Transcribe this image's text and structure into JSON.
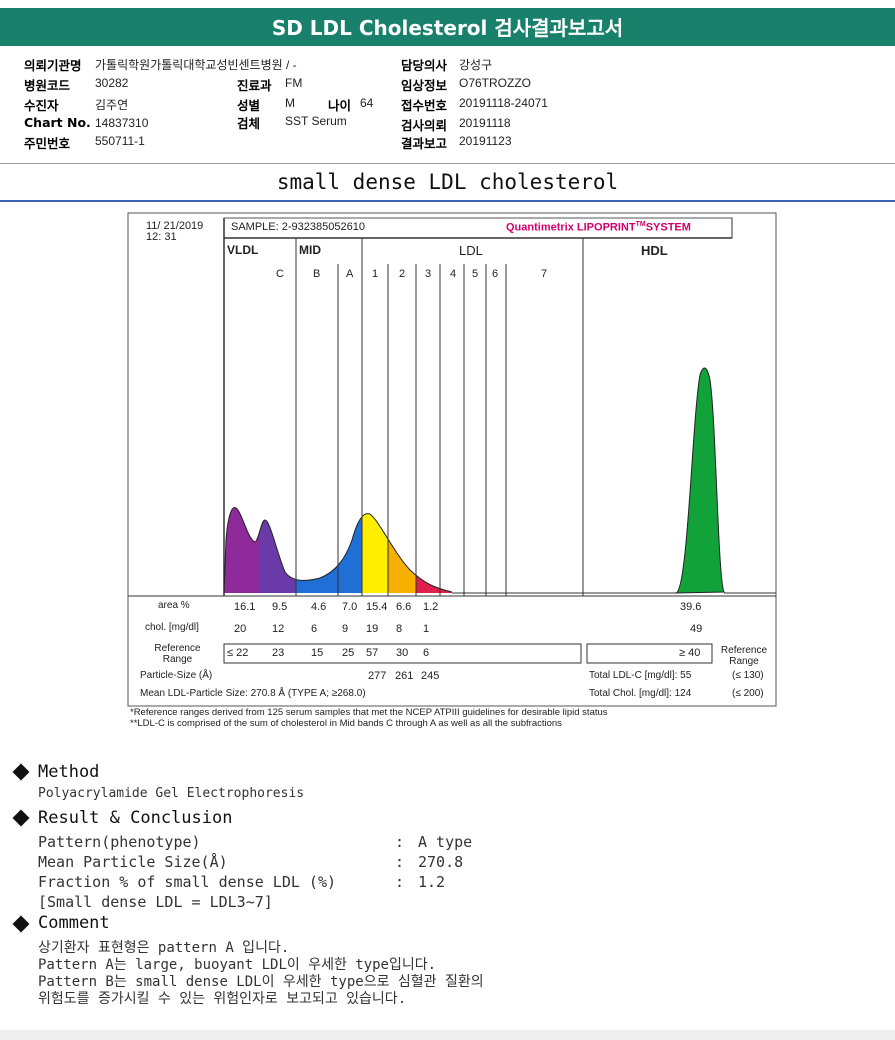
{
  "title": "SD LDL Cholesterol 검사결과보고서",
  "info": {
    "institution_label": "의뢰기관명",
    "institution": "가톨릭학원가톨릭대학교성빈센트병원 / -",
    "hospital_code_label": "병원코드",
    "hospital_code": "30282",
    "patient_label": "수진자",
    "patient": "김주연",
    "chart_label": "Chart No.",
    "chart": "14837310",
    "rrn_label": "주민번호",
    "rrn": "550711-1",
    "dept_label": "진료과",
    "dept": "FM",
    "sex_label": "성별",
    "sex": "M",
    "age_label": "나이",
    "age": "64",
    "specimen_label": "검체",
    "specimen": "SST Serum",
    "doctor_label": "담당의사",
    "doctor": "강성구",
    "clinical_label": "임상정보",
    "clinical": "O76TROZZO",
    "reception_label": "접수번호",
    "reception": "20191118-24071",
    "request_label": "검사의뢰",
    "request": "20191118",
    "report_label": "결과보고",
    "report": "20191123"
  },
  "subtitle": "small dense LDL cholesterol",
  "chart": {
    "date": "11/ 21/2019",
    "time": "12: 31",
    "sample": "SAMPLE:   2-932385052610",
    "brand": "Quantimetrix LIPOPRINT",
    "brand_tm": "TM",
    "brand_sys": "SYSTEM",
    "brand_color": "#d4006e",
    "groups": [
      "VLDL",
      "MID",
      "LDL",
      "HDL"
    ],
    "bands": [
      "C",
      "B",
      "A",
      "1",
      "2",
      "3",
      "4",
      "5",
      "6",
      "7"
    ],
    "area_label": "area %",
    "area": [
      "16.1",
      "9.5",
      "4.6",
      "7.0",
      "15.4",
      "6.6",
      "1.2"
    ],
    "area_hdl": "39.6",
    "chol_label": "chol. [mg/dl]",
    "chol": [
      "20",
      "12",
      "6",
      "9",
      "19",
      "8",
      "1"
    ],
    "chol_hdl": "49",
    "ref_label": "Reference Range",
    "ref": [
      "≤ 22",
      "23",
      "15",
      "25",
      "57",
      "30",
      "6"
    ],
    "ref_hdl": "≥ 40",
    "ref_label_right": "Reference Range",
    "ps_label": "Particle-Size (Å)",
    "ps": [
      "277",
      "261",
      "245"
    ],
    "mean_label": "Mean LDL-Particle Size:   270.8 Å  (TYPE A; ≥268.0)",
    "total_ldl": "Total LDL-C [mg/dl]:  55",
    "total_ldl_ref": "(≤ 130)",
    "total_chol": "Total Chol. [mg/dl]:   124",
    "total_chol_ref": "(≤ 200)",
    "note1": "*Reference ranges derived from 125 serum samples that met the NCEP ATPIII guidelines for desirable lipid status",
    "note2": "**LDL-C is comprised of the sum of cholesterol in Mid bands C through A as well as all the subfractions",
    "colors": {
      "vldl": "#8e2a9a",
      "midc": "#6a3aa8",
      "mid": "#1f6fd6",
      "ldl1": "#ffee00",
      "ldl2": "#f5b000",
      "ldl3": "#e0204a",
      "hdl": "#12a23a"
    }
  },
  "method": {
    "heading": "Method",
    "text": "Polyacrylamide Gel Electrophoresis"
  },
  "result": {
    "heading": "Result & Conclusion",
    "rows": [
      {
        "k": "Pattern(phenotype)",
        "v": "A type"
      },
      {
        "k": "Mean Particle Size(Å)",
        "v": "270.8"
      },
      {
        "k": "Fraction % of small dense LDL (%)",
        "v": "1.2"
      }
    ],
    "sep": ":",
    "note": "[Small dense LDL = LDL3~7]"
  },
  "comment": {
    "heading": "Comment",
    "lines": [
      "상기환자 표현형은 pattern A 입니다.",
      "Pattern A는 large, buoyant LDL이 우세한 type입니다.",
      "Pattern B는 small dense LDL이 우세한 type으로 심혈관 질환의",
      "위험도를 증가시킬 수 있는 위험인자로 보고되고 있습니다."
    ]
  }
}
